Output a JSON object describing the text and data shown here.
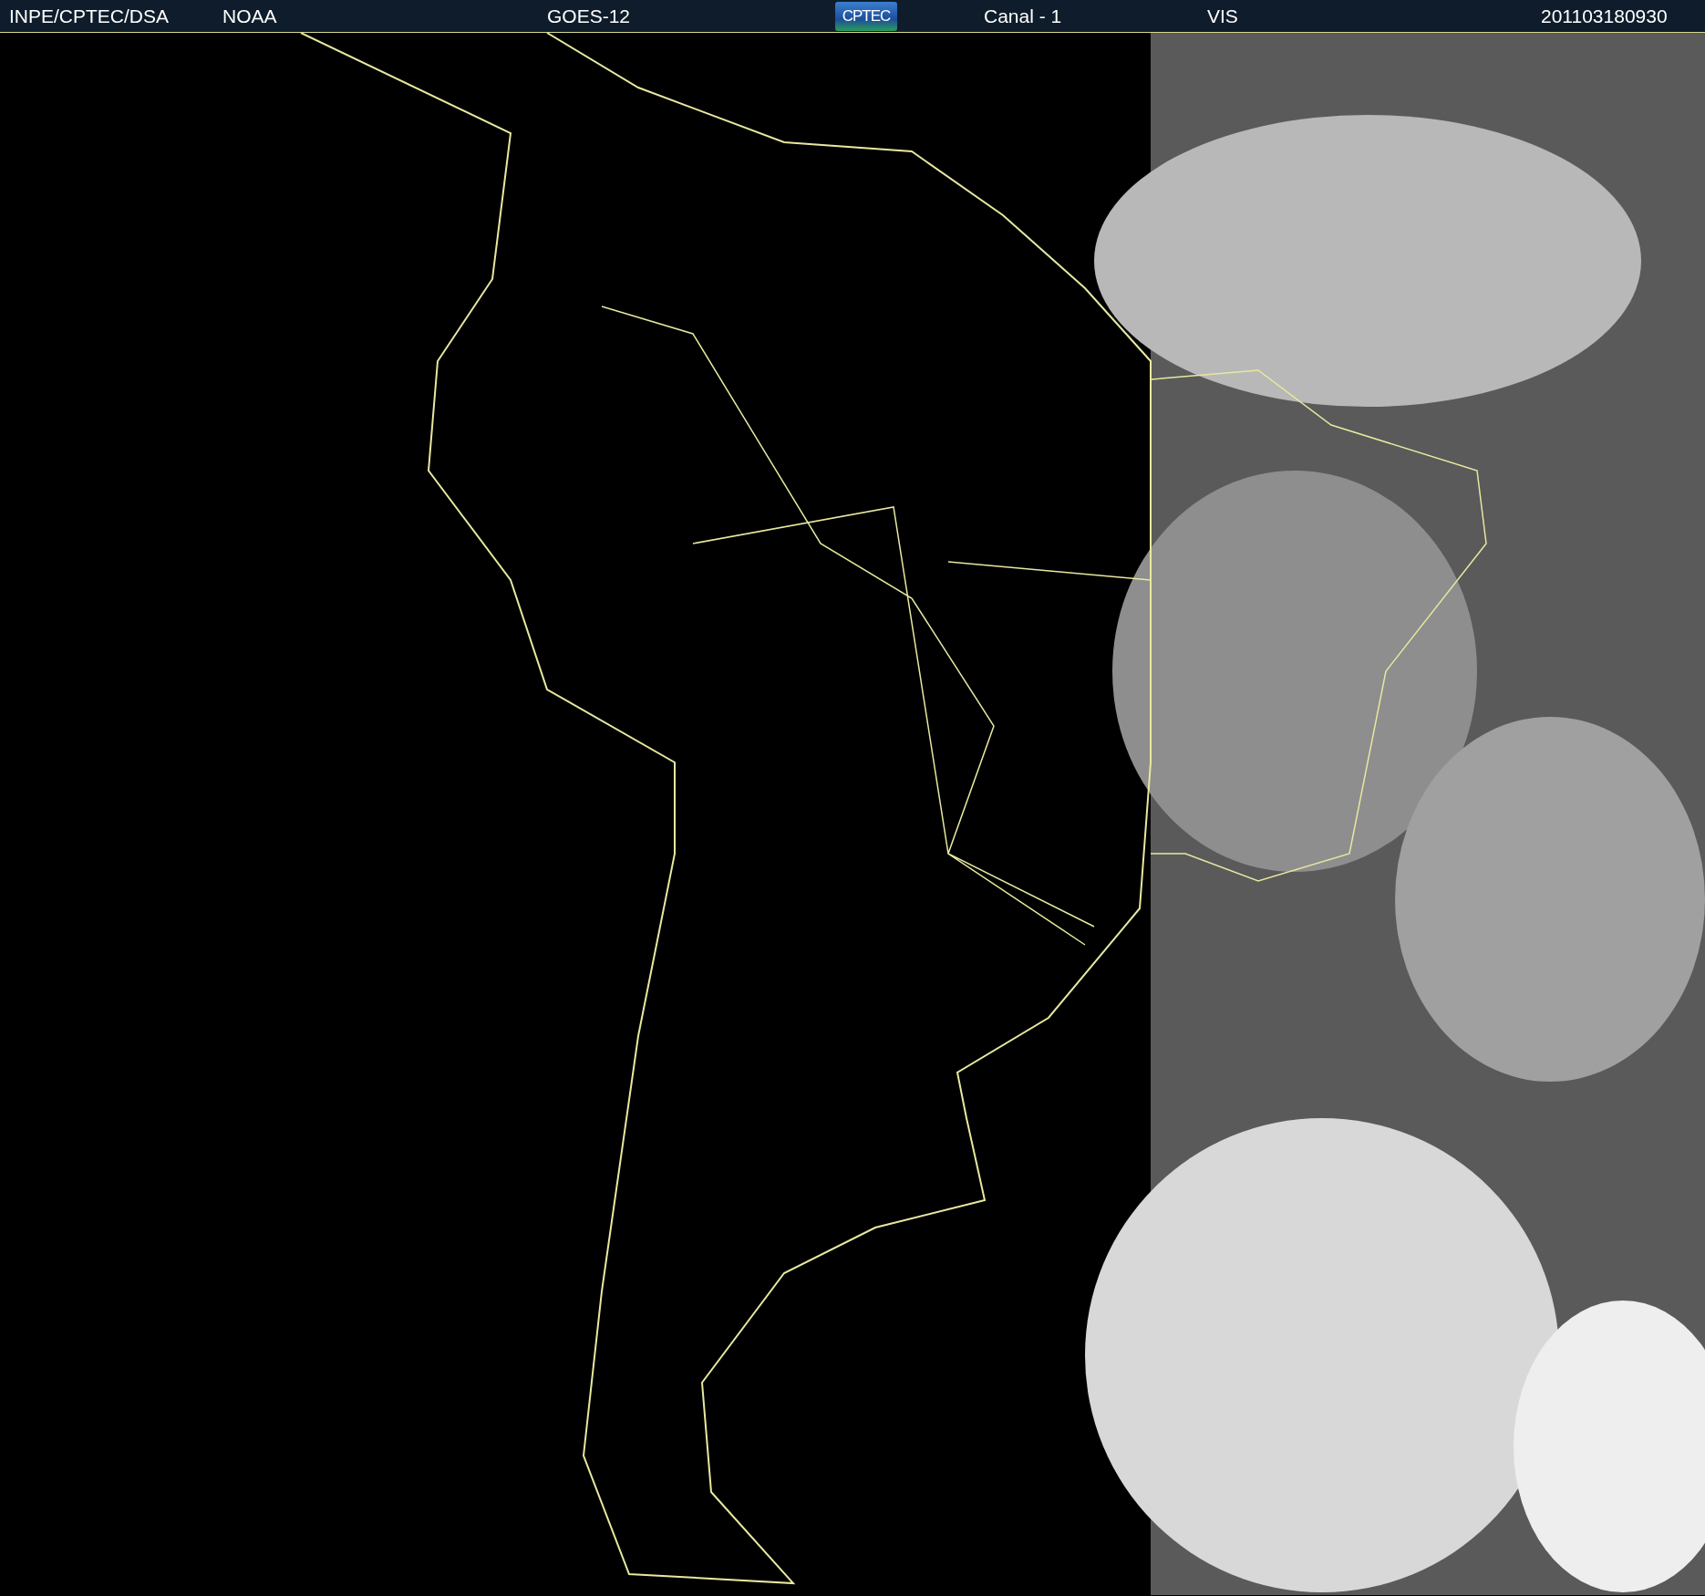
{
  "header": {
    "source": "INPE/CPTEC/DSA",
    "agency": "NOAA",
    "satellite": "GOES-12",
    "logo": "CPTEC",
    "channel": "Canal - 1",
    "band": "VIS",
    "timestamp": "201103180930"
  }
}
